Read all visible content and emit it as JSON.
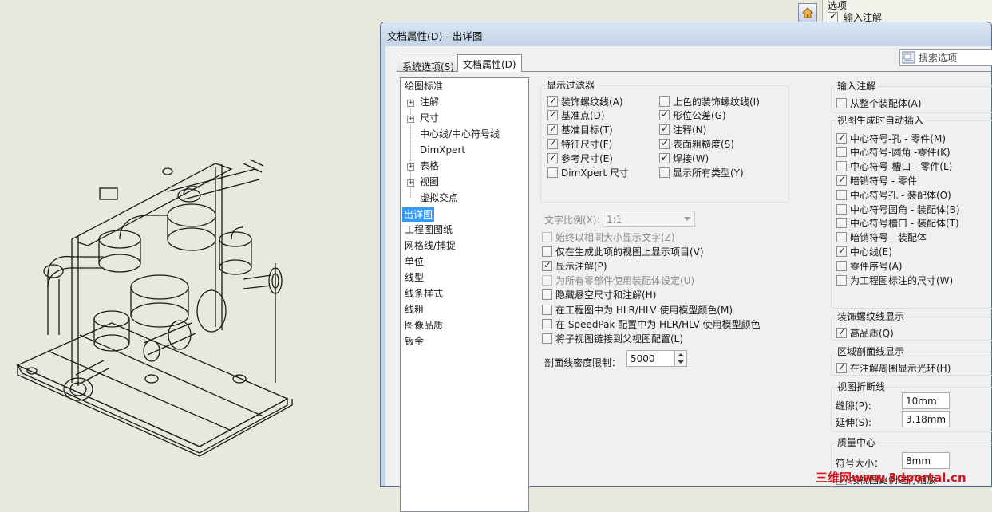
{
  "dialog": {
    "title": "文档属性(D) - 出详图"
  },
  "tabs": [
    {
      "label": "系统选项(S)"
    },
    {
      "label": "文档属性(D)"
    }
  ],
  "search": {
    "placeholder": "搜索选项"
  },
  "options_panel": {
    "title": "选项",
    "import_annotation": "输入注解"
  },
  "tree": {
    "items": [
      {
        "label": "绘图标准"
      },
      {
        "label": "注解"
      },
      {
        "label": "尺寸"
      },
      {
        "label": "中心线/中心符号线"
      },
      {
        "label": "DimXpert"
      },
      {
        "label": "表格"
      },
      {
        "label": "视图"
      },
      {
        "label": "虚拟交点"
      },
      {
        "label": "出详图"
      },
      {
        "label": "工程图图纸"
      },
      {
        "label": "网格线/捕捉"
      },
      {
        "label": "单位"
      },
      {
        "label": "线型"
      },
      {
        "label": "线条样式"
      },
      {
        "label": "线粗"
      },
      {
        "label": "图像品质"
      },
      {
        "label": "钣金"
      }
    ]
  },
  "display_filter": {
    "title": "显示过滤器",
    "left": [
      {
        "label": "装饰螺纹线(A)",
        "checked": true
      },
      {
        "label": "基准点(D)",
        "checked": true
      },
      {
        "label": "基准目标(T)",
        "checked": true
      },
      {
        "label": "特征尺寸(F)",
        "checked": true
      },
      {
        "label": "参考尺寸(E)",
        "checked": true
      },
      {
        "label": "DimXpert 尺寸",
        "checked": false
      }
    ],
    "right": [
      {
        "label": "上色的装饰螺纹线(I)",
        "checked": false
      },
      {
        "label": "形位公差(G)",
        "checked": true
      },
      {
        "label": "注释(N)",
        "checked": true
      },
      {
        "label": "表面粗糙度(S)",
        "checked": true
      },
      {
        "label": "焊接(W)",
        "checked": true
      },
      {
        "label": "显示所有类型(Y)",
        "checked": false
      }
    ]
  },
  "text_scale": {
    "label": "文字比例(X):",
    "value": "1:1"
  },
  "options": [
    {
      "label": "始终以相同大小显示文字(Z)",
      "checked": false,
      "disabled": true
    },
    {
      "label": "仅在生成此项的视图上显示项目(V)",
      "checked": false,
      "disabled": false
    },
    {
      "label": "显示注解(P)",
      "checked": true,
      "disabled": false
    },
    {
      "label": "为所有零部件使用装配体设定(U)",
      "checked": false,
      "disabled": true
    },
    {
      "label": "隐藏悬空尺寸和注解(H)",
      "checked": false,
      "disabled": false
    },
    {
      "label": "在工程图中为 HLR/HLV 使用模型颜色(M)",
      "checked": false,
      "disabled": false
    },
    {
      "label": "在 SpeedPak 配置中为 HLR/HLV 使用模型颜色",
      "checked": false,
      "disabled": false
    },
    {
      "label": "将子视图链接到父视图配置(L)",
      "checked": false,
      "disabled": false
    }
  ],
  "hatch_density": {
    "label": "剖面线密度限制：",
    "value": "5000"
  },
  "import_annotations": {
    "title": "输入注解",
    "items": [
      {
        "label": "从整个装配体(A)",
        "checked": false
      }
    ]
  },
  "auto_insert": {
    "title": "视图生成时自动插入",
    "items": [
      {
        "label": "中心符号-孔 - 零件(M)",
        "checked": true
      },
      {
        "label": "中心符号-圆角 -零件(K)",
        "checked": false
      },
      {
        "label": "中心符号-槽口 - 零件(L)",
        "checked": false
      },
      {
        "label": "暗销符号 - 零件",
        "checked": true
      },
      {
        "label": "中心符号孔 - 装配体(O)",
        "checked": false
      },
      {
        "label": "中心符号圆角 - 装配体(B)",
        "checked": false
      },
      {
        "label": "中心符号槽口 - 装配体(T)",
        "checked": false
      },
      {
        "label": "暗销符号 - 装配体",
        "checked": false
      },
      {
        "label": "中心线(E)",
        "checked": true
      },
      {
        "label": "零件序号(A)",
        "checked": false
      },
      {
        "label": "为工程图标注的尺寸(W)",
        "checked": false
      }
    ]
  },
  "cosmetic_thread": {
    "title": "装饰螺纹线显示",
    "items": [
      {
        "label": "高品质(Q)",
        "checked": true
      }
    ]
  },
  "area_hatch": {
    "title": "区域剖面线显示",
    "items": [
      {
        "label": "在注解周围显示光环(H)",
        "checked": true
      }
    ]
  },
  "break_line": {
    "title": "视图折断线",
    "gap_label": "缝隙(P):",
    "gap_value": "10mm",
    "extension_label": "延伸(S):",
    "extension_value": "3.18mm"
  },
  "center_of_mass": {
    "title": "质量中心",
    "size_label": "符号大小：",
    "size_value": "8mm",
    "items": [
      {
        "label": "按视图比例进行缩放",
        "checked": false
      }
    ]
  },
  "watermark": {
    "text": "三维网www.3dportal.cn",
    "color": "#d2141c"
  }
}
